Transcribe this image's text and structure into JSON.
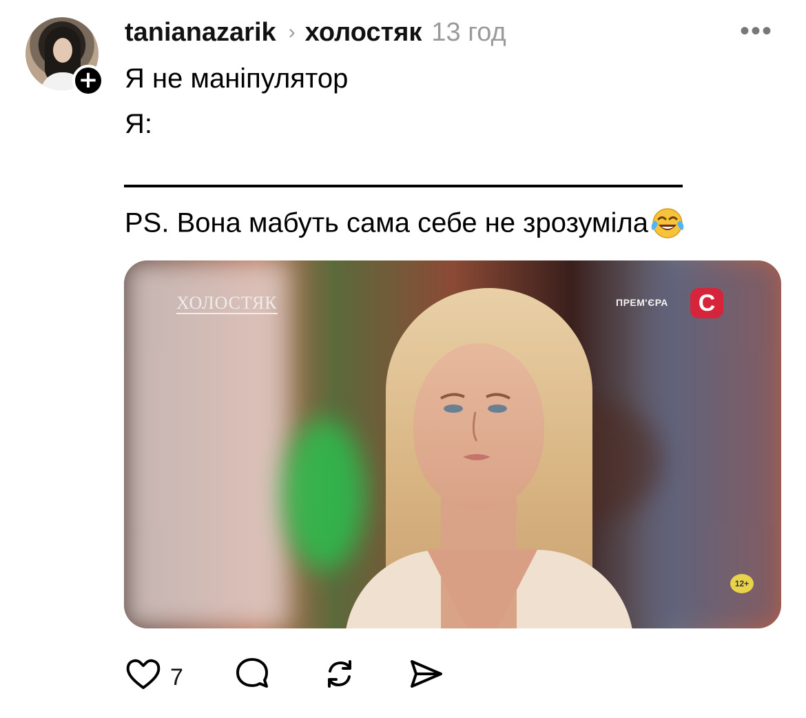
{
  "post": {
    "username": "tanianazarik",
    "chevron": "›",
    "topic": "холостяк",
    "time": "13 год",
    "more": "•••",
    "line1": "Я не маніпулятор",
    "line2": "Я:",
    "ps": "PS. Вона мабуть сама себе не зрозуміла",
    "emoji": "face-with-tears-of-joy"
  },
  "media": {
    "show_logo": "ХОЛОСТЯК",
    "premiere": "ПРЕМ'ЄРА",
    "channel": "С",
    "age_rating": "12+"
  },
  "actions": {
    "like_icon": "heart-icon",
    "like_count": "7",
    "comment_icon": "comment-icon",
    "repost_icon": "repost-icon",
    "share_icon": "share-icon"
  },
  "colors": {
    "text": "#000000",
    "muted": "#9a9a9a",
    "channel_red": "#d6243a"
  }
}
